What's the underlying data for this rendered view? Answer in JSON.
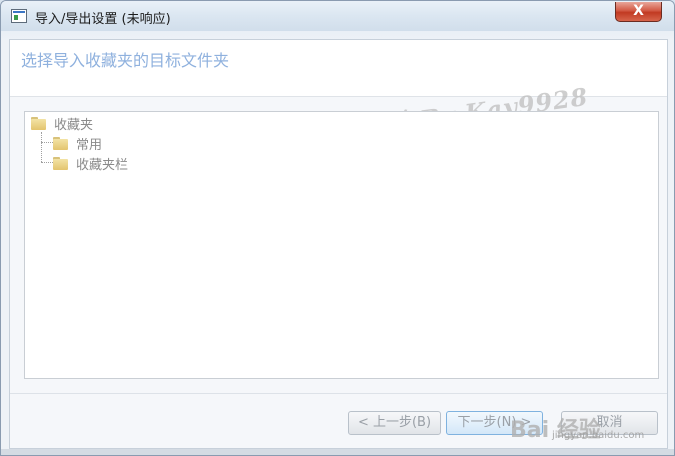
{
  "window": {
    "title": "导入/导出设置 (未响应)",
    "close_label": "X"
  },
  "instruction": "选择导入收藏夹的目标文件夹",
  "watermark": "百度经验 By Kay9928",
  "tree": {
    "root": "收藏夹",
    "children": [
      "常用",
      "收藏夹栏"
    ]
  },
  "buttons": {
    "prev": "< 上一步(B)",
    "next": "下一步(N) >",
    "cancel": "取消"
  },
  "baidu_watermark": {
    "logo": "Bai 经验",
    "url": "jingyan.baidu.com"
  },
  "colors": {
    "instruction_text": "#8fb1de",
    "close_button": "#c13a22",
    "disabled_text": "#9aa0a7"
  }
}
